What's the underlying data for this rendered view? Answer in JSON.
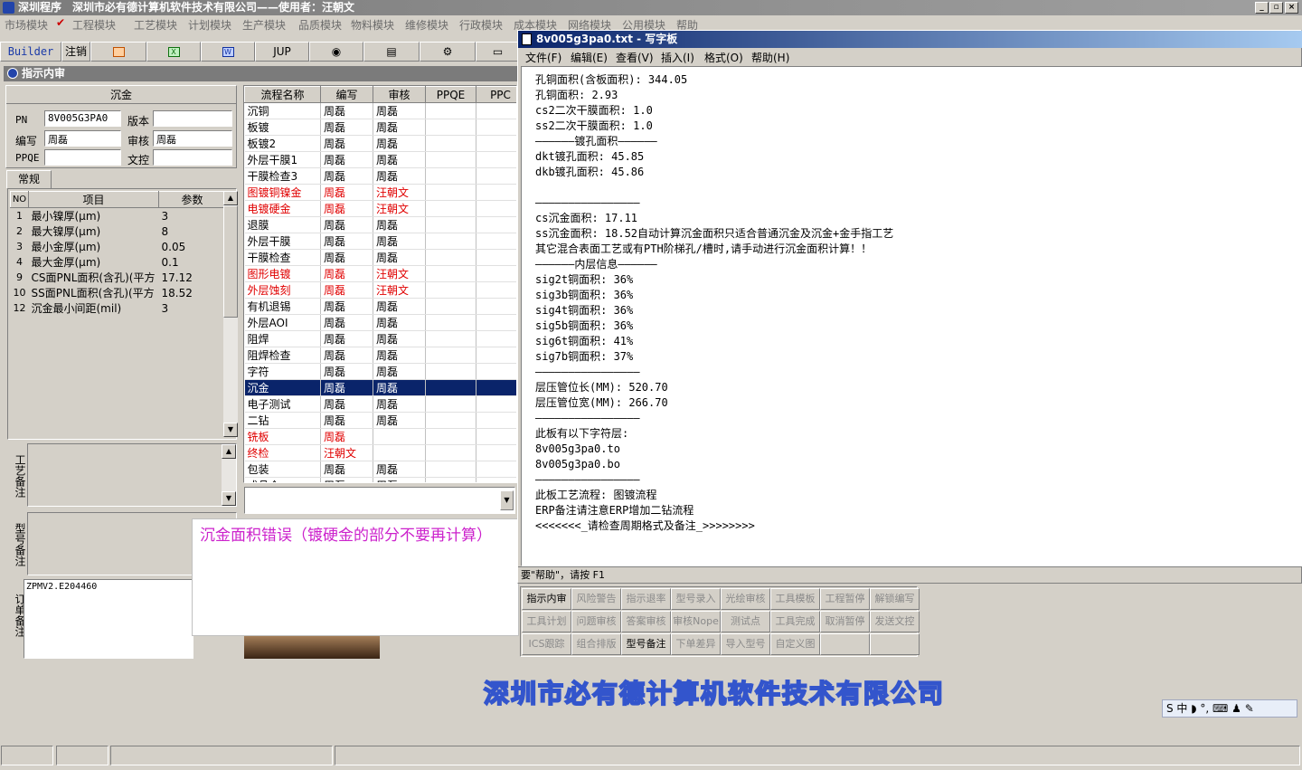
{
  "app": {
    "title": "深圳程序　深圳市必有德计算机软件技术有限公司——使用者：汪朝文",
    "menu": [
      "市场模块",
      "工程模块",
      "工艺模块",
      "计划模块",
      "生产模块",
      "品质模块",
      "物料模块",
      "维修模块",
      "行政模块",
      "成本模块",
      "网络模块",
      "公用模块",
      "帮助"
    ]
  },
  "toolbar": {
    "builder": "Builder",
    "logout": "注销",
    "jup": "JUP"
  },
  "panel": {
    "title": "指示内审",
    "section": "沉金",
    "fields": {
      "pn_label": "PN",
      "pn": "8V005G3PA0",
      "version_label": "版本",
      "version": "",
      "author_label": "编写",
      "author": "周磊",
      "review_label": "审核",
      "review": "周磊",
      "ppqe_label": "PPQE",
      "ppqe": "",
      "doc_label": "文控",
      "doc": ""
    },
    "tab": "常规",
    "params": {
      "headers": [
        "NO",
        "项目",
        "参数"
      ],
      "rows": [
        [
          "1",
          "最小镍厚(μm)",
          "3"
        ],
        [
          "2",
          "最大镍厚(μm)",
          "8"
        ],
        [
          "3",
          "最小金厚(μm)",
          "0.05"
        ],
        [
          "4",
          "最大金厚(μm)",
          "0.1"
        ],
        [
          "9",
          "CS面PNL面积(含孔)(平方",
          "17.12"
        ],
        [
          "10",
          "SS面PNL面积(含孔)(平方",
          "18.52"
        ],
        [
          "12",
          "沉金最小间距(mil)",
          "3"
        ]
      ]
    },
    "remarks": {
      "craft": "工艺备注",
      "model": "型号备注",
      "order": "订单备注",
      "order_value": "ZPMV2.E204460"
    }
  },
  "process": {
    "headers": [
      "流程名称",
      "编写",
      "审核",
      "PPQE",
      "PPC"
    ],
    "rows": [
      {
        "name": "沉铜",
        "author": "周磊",
        "review": "周磊",
        "red": false
      },
      {
        "name": "板镀",
        "author": "周磊",
        "review": "周磊",
        "red": false
      },
      {
        "name": "板镀2",
        "author": "周磊",
        "review": "周磊",
        "red": false
      },
      {
        "name": "外层干膜1",
        "author": "周磊",
        "review": "周磊",
        "red": false
      },
      {
        "name": "干膜检查3",
        "author": "周磊",
        "review": "周磊",
        "red": false
      },
      {
        "name": "图镀铜镍金",
        "author": "周磊",
        "review": "汪朝文",
        "red": true
      },
      {
        "name": "电镀硬金",
        "author": "周磊",
        "review": "汪朝文",
        "red": true
      },
      {
        "name": "退膜",
        "author": "周磊",
        "review": "周磊",
        "red": false
      },
      {
        "name": "外层干膜",
        "author": "周磊",
        "review": "周磊",
        "red": false
      },
      {
        "name": "干膜检查",
        "author": "周磊",
        "review": "周磊",
        "red": false
      },
      {
        "name": "图形电镀",
        "author": "周磊",
        "review": "汪朝文",
        "red": true
      },
      {
        "name": "外层蚀刻",
        "author": "周磊",
        "review": "汪朝文",
        "red": true
      },
      {
        "name": "有机退锡",
        "author": "周磊",
        "review": "周磊",
        "red": false
      },
      {
        "name": "外层AOI",
        "author": "周磊",
        "review": "周磊",
        "red": false
      },
      {
        "name": "阻焊",
        "author": "周磊",
        "review": "周磊",
        "red": false
      },
      {
        "name": "阻焊检查",
        "author": "周磊",
        "review": "周磊",
        "red": false
      },
      {
        "name": "字符",
        "author": "周磊",
        "review": "周磊",
        "red": false
      },
      {
        "name": "沉金",
        "author": "周磊",
        "review": "周磊",
        "red": false,
        "selected": true
      },
      {
        "name": "电子测试",
        "author": "周磊",
        "review": "周磊",
        "red": false
      },
      {
        "name": "二钻",
        "author": "周磊",
        "review": "周磊",
        "red": false
      },
      {
        "name": "铣板",
        "author": "周磊",
        "review": "",
        "red": true
      },
      {
        "name": "终检",
        "author": "汪朝文",
        "review": "",
        "red": true
      },
      {
        "name": "包装",
        "author": "周磊",
        "review": "周磊",
        "red": false
      },
      {
        "name": "成品仓",
        "author": "周磊",
        "review": "周磊",
        "red": false
      }
    ]
  },
  "notepad": {
    "title": "8v005g3pa0.txt - 写字板",
    "menu": [
      "文件(F)",
      "编辑(E)",
      "查看(V)",
      "插入(I)",
      "格式(O)",
      "帮助(H)"
    ],
    "lines": [
      "孔铜面积(含板面积): 344.05",
      "孔铜面积: 2.93",
      "cs2二次干膜面积: 1.0",
      "ss2二次干膜面积: 1.0",
      "——————镀孔面积——————",
      "dkt镀孔面积: 45.85",
      "dkb镀孔面积: 45.86",
      "",
      "————————————————",
      "cs沉金面积: 17.11",
      "ss沉金面积: 18.52自动计算沉金面积只适合普通沉金及沉金+金手指工艺",
      "其它混合表面工艺或有PTH阶梯孔/槽时,请手动进行沉金面积计算！！",
      "——————内层信息——————",
      "sig2t铜面积: 36%",
      "sig3b铜面积: 36%",
      "sig4t铜面积: 36%",
      "sig5b铜面积: 36%",
      "sig6t铜面积: 41%",
      "sig7b铜面积: 37%",
      "————————————————",
      "层压管位长(MM): 520.70",
      "层压管位宽(MM): 266.70",
      "————————————————",
      "此板有以下字符层:",
      "8v005g3pa0.to",
      "8v005g3pa0.bo",
      "————————————————",
      "此板工艺流程: 图镀流程",
      "ERP备注请注意ERP增加二钻流程",
      "<<<<<<<_请检查周期格式及备注_>>>>>>>>"
    ],
    "status": "要\"帮助\"，请按 F1"
  },
  "buttons": [
    [
      "指示内审",
      "风险警告",
      "指示退率",
      "型号录入",
      "光绘审核",
      "工具模板",
      "工程暂停",
      "解锁编写"
    ],
    [
      "工具计划",
      "问题审核",
      "答案审核",
      "审核Nope",
      "测试点",
      "工具完成",
      "取消暂停",
      "发送文控"
    ],
    [
      "ICS跟踪",
      "组合排版",
      "型号备注",
      "下单差异",
      "导入型号",
      "自定义图",
      "",
      ""
    ]
  ],
  "active_buttons": [
    "指示内审",
    "型号备注"
  ],
  "popup": "沉金面积错误（镀硬金的部分不要再计算）",
  "banner": "深圳市必有德计算机软件技术有限公司",
  "ime": "S 中 ◗ °, ⌨ ♟ ✎",
  "colors": {
    "selection": "#0a246a",
    "red": "#e00000",
    "popup_text": "#cc22cc",
    "title_active": "#0a246a"
  }
}
